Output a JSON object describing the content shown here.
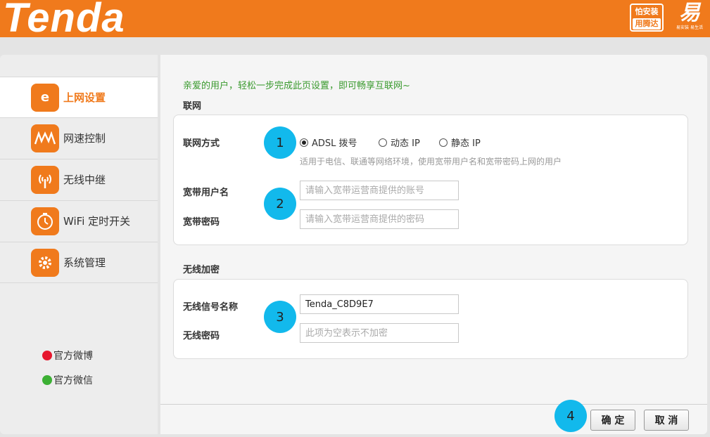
{
  "header": {
    "logo": "Tenda",
    "badge_a_top": "怕安装",
    "badge_a_bottom": "用腾达",
    "badge_b_glyph": "易",
    "badge_b_sub": "易安装 易生活"
  },
  "sidebar": {
    "items": [
      {
        "label": "上网设置",
        "icon": "ie-globe-icon"
      },
      {
        "label": "网速控制",
        "icon": "speed-wave-icon"
      },
      {
        "label": "无线中继",
        "icon": "wireless-signal-icon"
      },
      {
        "label": "WiFi 定时开关",
        "icon": "timer-icon"
      },
      {
        "label": "系统管理",
        "icon": "gear-icon"
      }
    ],
    "weibo": "官方微博",
    "wechat": "官方微信"
  },
  "main": {
    "welcome": "亲爱的用户，轻松一步完成此页设置，即可畅享互联网~",
    "network_section": "联网",
    "connection_label": "联网方式",
    "radio_options": [
      "ADSL 拨号",
      "动态 IP",
      "静态 IP"
    ],
    "selected_option": "ADSL 拨号",
    "hint": "适用于电信、联通等网络环境，使用宽带用户名和宽带密码上网的用户",
    "username_label": "宽带用户名",
    "username_placeholder": "请输入宽带运营商提供的账号",
    "password_label": "宽带密码",
    "password_placeholder": "请输入宽带运营商提供的密码",
    "wireless_section": "无线加密",
    "ssid_label": "无线信号名称",
    "ssid_value": "Tenda_C8D9E7",
    "wifi_password_label": "无线密码",
    "wifi_password_placeholder": "此项为空表示不加密"
  },
  "steps": [
    "1",
    "2",
    "3",
    "4"
  ],
  "buttons": {
    "ok": "确 定",
    "cancel": "取 消"
  },
  "colors": {
    "brand": "#f07a1c",
    "step": "#12b9ec",
    "welcome": "#3a9a2e"
  }
}
